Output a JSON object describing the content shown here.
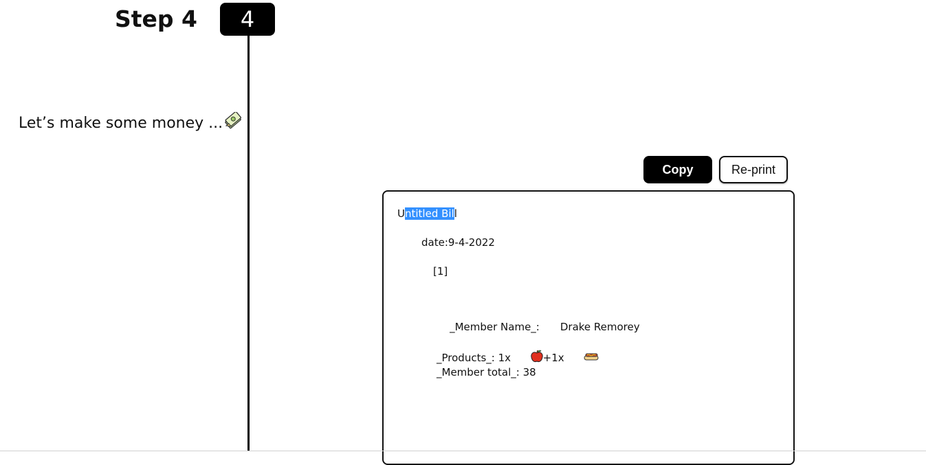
{
  "step": {
    "title": "Step 4",
    "number": "4"
  },
  "tagline": {
    "text": "Let’s make some money ...",
    "icon": "money-bills-icon"
  },
  "actions": {
    "copy_label": "Copy",
    "reprint_label": "Re-print"
  },
  "bill": {
    "title_prefix": "U",
    "title_selected": "ntitled Bil",
    "title_suffix": "l",
    "date": "date:9-4-2022",
    "index": "[1]",
    "member_name_label": "_Member Name_:",
    "member_name_value": "Drake Remorey",
    "products_label": "_Products_: 1x",
    "products_sep": "+1x",
    "product_icons": [
      "apple-icon",
      "hot-dog-icon"
    ],
    "member_total": "_Member total_: 38"
  },
  "colors": {
    "selection": "#3390ff",
    "accent": "#000000"
  }
}
